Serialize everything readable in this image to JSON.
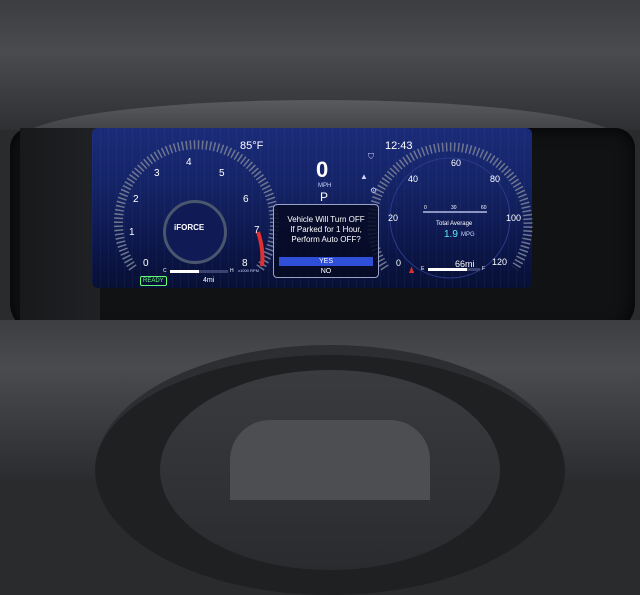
{
  "status_bar": {
    "outside_temp": "85°F",
    "clock": "12:43"
  },
  "speed_display": {
    "value": "0",
    "unit": "MPH",
    "gear": "P"
  },
  "tachometer": {
    "labels": [
      "0",
      "1",
      "2",
      "3",
      "4",
      "5",
      "6",
      "7",
      "8"
    ],
    "unit": "x1000\nRPM",
    "brand": "iFORCE",
    "hybrid_status": "READY",
    "trip": "4mi",
    "gauge_cold_label": "C",
    "gauge_hot_label": "H"
  },
  "speedometer": {
    "labels": [
      "0",
      "20",
      "40",
      "60",
      "80",
      "100",
      "120"
    ]
  },
  "popup": {
    "message": "Vehicle Will Turn OFF\nIf Parked for 1 Hour,\nPerform Auto OFF?",
    "yes_label": "YES",
    "no_label": "NO"
  },
  "fuel_economy": {
    "scale": [
      "0",
      "30",
      "60"
    ],
    "label": "Total Average",
    "value": "1.9",
    "unit": "MPG"
  },
  "fuel": {
    "range": "66mi",
    "empty_label": "E",
    "full_label": "F",
    "level_fraction": 0.75
  },
  "engine_temp": {
    "level_fraction": 0.5
  },
  "colors": {
    "display_bg": "#152466",
    "accent_blue": "#2f4fd8",
    "ready_green": "#64ff73",
    "economy_cyan": "#5cf0ff",
    "redline": "#e03030"
  },
  "icons": [
    "lane-assist-icon",
    "driver-assist-icon",
    "traction-off-icon",
    "seatbelt-warning-icon"
  ]
}
